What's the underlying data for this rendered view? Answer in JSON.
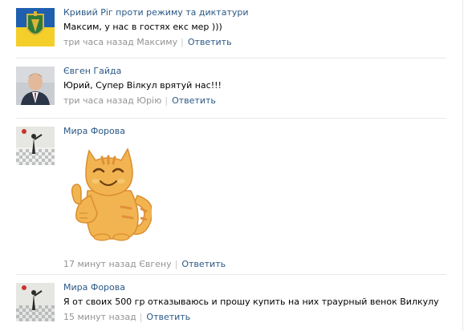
{
  "comments": [
    {
      "author": "Кривий Ріг проти режиму та диктатури",
      "text": "Максим, у нас в гостях екс мер )))",
      "time": "три часа назад",
      "reply_to": "Максиму",
      "reply_label": "Ответить"
    },
    {
      "author": "Євген Гайда",
      "text": "Юрий, Супер Вілкул врятуй нас!!!",
      "time": "три часа назад",
      "reply_to": "Юрію",
      "reply_label": "Ответить"
    },
    {
      "author": "Мира Форова",
      "time": "17 минут назад",
      "reply_to": "Євгену",
      "reply_label": "Ответить"
    },
    {
      "author": "Мира Форова",
      "text": "Я от своих 500 гр отказываюсь и прошу купить на них траурный венок Вилкулу",
      "time": "15 минут назад",
      "reply_label": "Ответить"
    }
  ],
  "colors": {
    "link": "#2a5885",
    "meta": "#939393",
    "divider": "#e7e8ec",
    "sticker_fur": "#f2b451",
    "sticker_stripe": "#e0903a"
  }
}
